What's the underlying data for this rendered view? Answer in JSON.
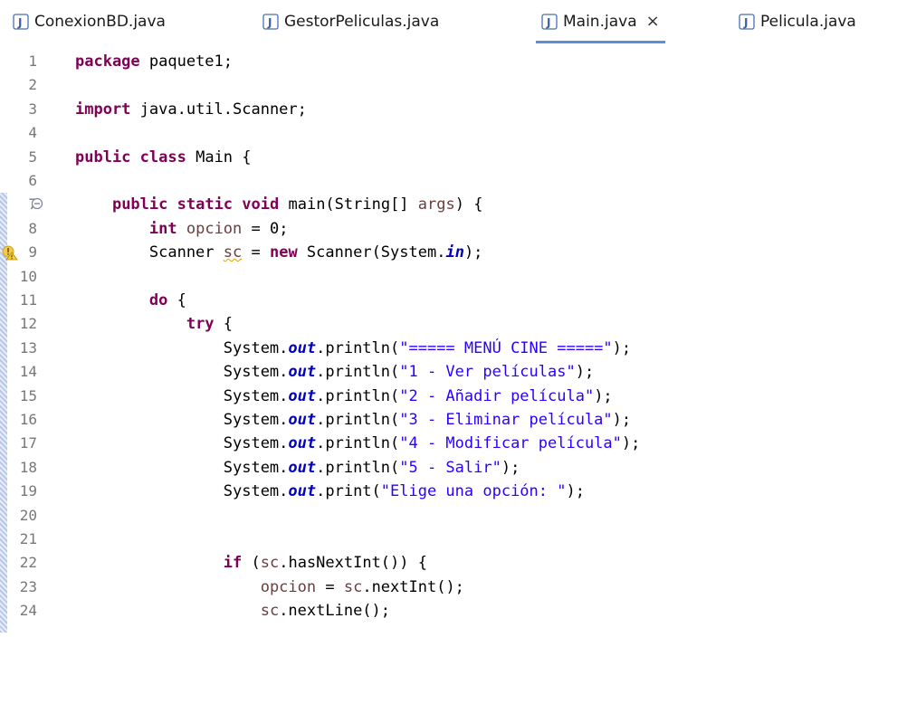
{
  "tabs": [
    {
      "label": "ConexionBD.java",
      "active": false
    },
    {
      "label": "GestorPeliculas.java",
      "active": false
    },
    {
      "label": "Main.java",
      "active": true,
      "close": "×"
    },
    {
      "label": "Pelicula.java",
      "active": false
    }
  ],
  "lines": [
    {
      "n": "1",
      "code": [
        {
          "k": "kw",
          "t": "package"
        },
        {
          "t": " paquete1;"
        }
      ]
    },
    {
      "n": "2",
      "code": []
    },
    {
      "n": "3",
      "code": [
        {
          "k": "kw",
          "t": "import"
        },
        {
          "t": " java.util.Scanner;"
        }
      ]
    },
    {
      "n": "4",
      "code": []
    },
    {
      "n": "5",
      "code": [
        {
          "k": "kw",
          "t": "public"
        },
        {
          "t": " "
        },
        {
          "k": "kw",
          "t": "class"
        },
        {
          "t": " Main {"
        }
      ]
    },
    {
      "n": "6",
      "code": []
    },
    {
      "n": "7",
      "fold": true,
      "code": [
        {
          "t": "    "
        },
        {
          "k": "kw",
          "t": "public"
        },
        {
          "t": " "
        },
        {
          "k": "kw",
          "t": "static"
        },
        {
          "t": " "
        },
        {
          "k": "kw",
          "t": "void"
        },
        {
          "t": " main(String[] "
        },
        {
          "k": "var",
          "t": "args"
        },
        {
          "t": ") {"
        }
      ]
    },
    {
      "n": "8",
      "code": [
        {
          "t": "        "
        },
        {
          "k": "kw",
          "t": "int"
        },
        {
          "t": " "
        },
        {
          "k": "var",
          "t": "opcion"
        },
        {
          "t": " = 0;"
        }
      ]
    },
    {
      "n": "9",
      "warning": true,
      "code": [
        {
          "t": "        Scanner "
        },
        {
          "k": "warnvar",
          "t": "sc"
        },
        {
          "t": " = "
        },
        {
          "k": "kw",
          "t": "new"
        },
        {
          "t": " Scanner(System."
        },
        {
          "k": "fld",
          "t": "in"
        },
        {
          "t": ");"
        }
      ]
    },
    {
      "n": "10",
      "code": []
    },
    {
      "n": "11",
      "code": [
        {
          "t": "        "
        },
        {
          "k": "kw",
          "t": "do"
        },
        {
          "t": " {"
        }
      ]
    },
    {
      "n": "12",
      "code": [
        {
          "t": "            "
        },
        {
          "k": "kw",
          "t": "try"
        },
        {
          "t": " {"
        }
      ]
    },
    {
      "n": "13",
      "code": [
        {
          "t": "                System."
        },
        {
          "k": "fld",
          "t": "out"
        },
        {
          "t": ".println("
        },
        {
          "k": "str",
          "t": "\"===== MENÚ CINE =====\""
        },
        {
          "t": ");"
        }
      ]
    },
    {
      "n": "14",
      "code": [
        {
          "t": "                System."
        },
        {
          "k": "fld",
          "t": "out"
        },
        {
          "t": ".println("
        },
        {
          "k": "str",
          "t": "\"1 - Ver películas\""
        },
        {
          "t": ");"
        }
      ]
    },
    {
      "n": "15",
      "code": [
        {
          "t": "                System."
        },
        {
          "k": "fld",
          "t": "out"
        },
        {
          "t": ".println("
        },
        {
          "k": "str",
          "t": "\"2 - Añadir película\""
        },
        {
          "t": ");"
        }
      ]
    },
    {
      "n": "16",
      "code": [
        {
          "t": "                System."
        },
        {
          "k": "fld",
          "t": "out"
        },
        {
          "t": ".println("
        },
        {
          "k": "str",
          "t": "\"3 - Eliminar película\""
        },
        {
          "t": ");"
        }
      ]
    },
    {
      "n": "17",
      "code": [
        {
          "t": "                System."
        },
        {
          "k": "fld",
          "t": "out"
        },
        {
          "t": ".println("
        },
        {
          "k": "str",
          "t": "\"4 - Modificar película\""
        },
        {
          "t": ");"
        }
      ]
    },
    {
      "n": "18",
      "code": [
        {
          "t": "                System."
        },
        {
          "k": "fld",
          "t": "out"
        },
        {
          "t": ".println("
        },
        {
          "k": "str",
          "t": "\"5 - Salir\""
        },
        {
          "t": ");"
        }
      ]
    },
    {
      "n": "19",
      "code": [
        {
          "t": "                System."
        },
        {
          "k": "fld",
          "t": "out"
        },
        {
          "t": ".print("
        },
        {
          "k": "str",
          "t": "\"Elige una opción: \""
        },
        {
          "t": ");"
        }
      ]
    },
    {
      "n": "20",
      "code": []
    },
    {
      "n": "21",
      "code": []
    },
    {
      "n": "22",
      "code": [
        {
          "t": "                "
        },
        {
          "k": "kw",
          "t": "if"
        },
        {
          "t": " ("
        },
        {
          "k": "var",
          "t": "sc"
        },
        {
          "t": ".hasNextInt()) {"
        }
      ]
    },
    {
      "n": "23",
      "code": [
        {
          "t": "                    "
        },
        {
          "k": "var",
          "t": "opcion"
        },
        {
          "t": " = "
        },
        {
          "k": "var",
          "t": "sc"
        },
        {
          "t": ".nextInt();"
        }
      ]
    },
    {
      "n": "24",
      "code": [
        {
          "t": "                    "
        },
        {
          "k": "var",
          "t": "sc"
        },
        {
          "t": ".nextLine();"
        }
      ]
    }
  ],
  "colors": {
    "keyword": "#7f0055",
    "string": "#2a00ff",
    "field": "#0000c0",
    "local_variable": "#6a3e3e",
    "tab_underline": "#5b8fd6"
  },
  "icons": {
    "tab_file": "java-file-icon",
    "fold": "collapse-icon",
    "warning": "warning-icon"
  }
}
